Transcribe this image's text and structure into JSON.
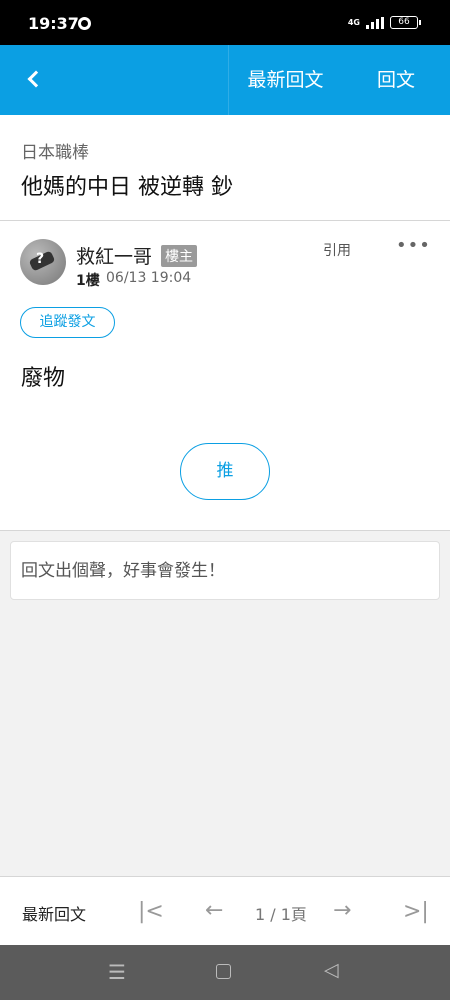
{
  "status_bar": {
    "time": "19:37",
    "network": "4G",
    "battery": "66"
  },
  "header": {
    "latest_label": "最新回文",
    "reply_label": "回文"
  },
  "thread": {
    "category": "日本職棒",
    "title": "他媽的中日 被逆轉 鈔"
  },
  "post": {
    "author": "救紅一哥",
    "op_badge": "樓主",
    "floor": "1樓",
    "time": "06/13 19:04",
    "quote_label": "引用",
    "more_label": "•••",
    "follow_label": "追蹤發文",
    "body": "廢物",
    "push_label": "推"
  },
  "reply_box": {
    "placeholder": "回文出個聲，好事會發生！"
  },
  "pager": {
    "latest_label": "最新回文",
    "page_text": "1 / 1頁"
  },
  "colors": {
    "accent": "#0b9fe3",
    "status_bar": "#000000",
    "nav_bar": "#5b5b5b"
  },
  "icons": {
    "back": "chevron-left-icon",
    "first_page": "first-page-icon",
    "prev_page": "arrow-left-icon",
    "next_page": "arrow-right-icon",
    "last_page": "last-page-icon"
  }
}
